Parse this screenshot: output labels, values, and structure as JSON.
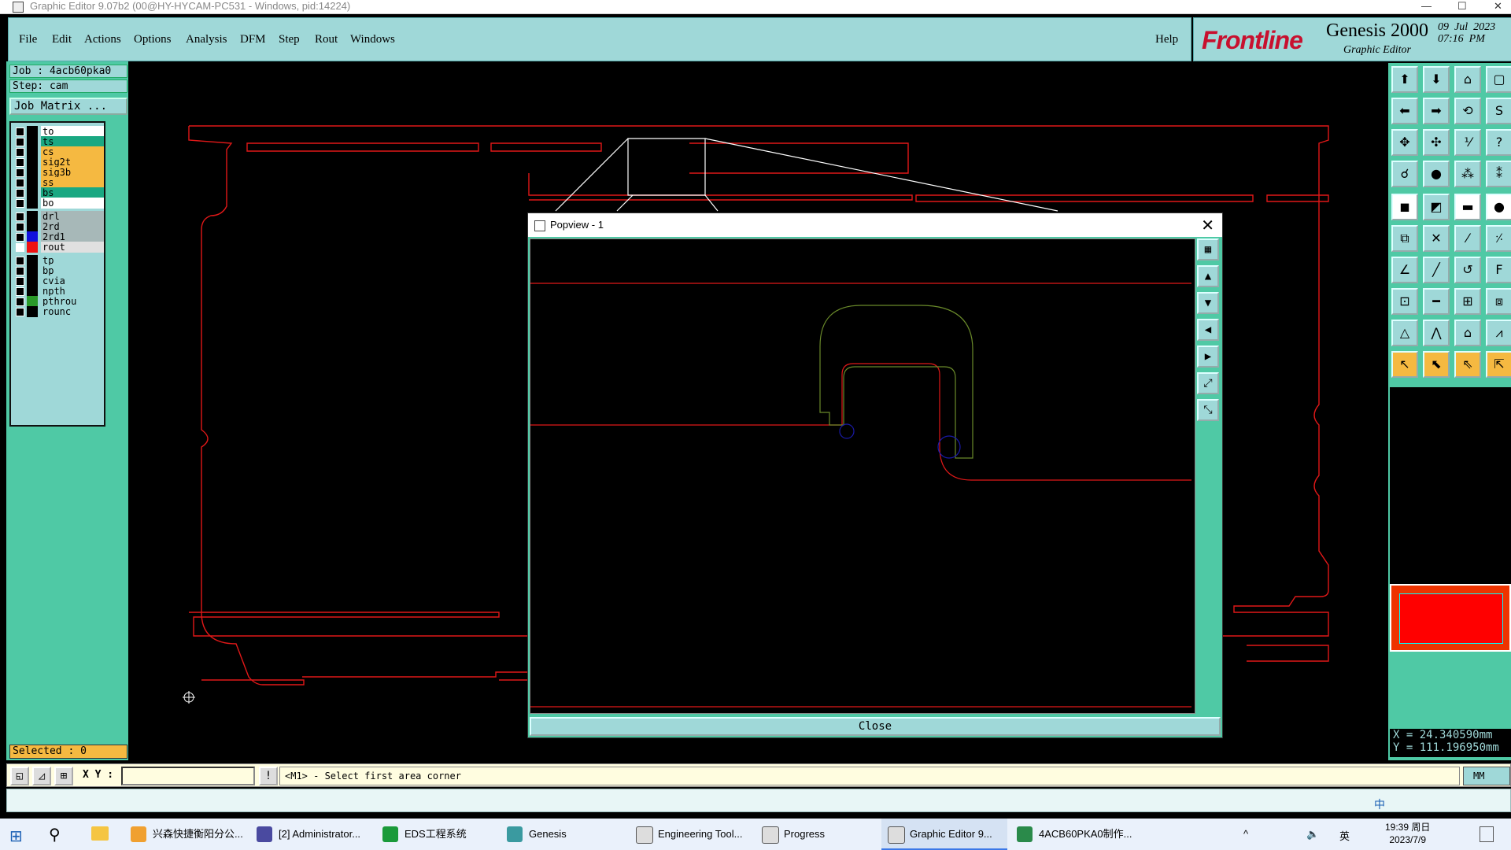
{
  "window": {
    "title": "Graphic Editor 9.07b2 (00@HY-HYCAM-PC531 - Windows, pid:14224)",
    "minimize": "—",
    "maximize": "☐",
    "close": "✕"
  },
  "menu": [
    "File",
    "Edit",
    "Actions",
    "Options",
    "Analysis",
    "DFM",
    "Step",
    "Rout",
    "Windows"
  ],
  "help": "Help",
  "brand": {
    "logo": "Frontline",
    "product": "Genesis 2000",
    "subtitle": "Graphic Editor",
    "date": "09  Jul  2023",
    "time": "07:16  PM"
  },
  "job": {
    "job": "Job : 4acb60pka0",
    "step": "Step: cam",
    "matrix": "Job Matrix ..."
  },
  "layers": [
    {
      "name": "to",
      "color": "#ffffff",
      "swatch": "#000000",
      "checked": false
    },
    {
      "name": "ts",
      "color": "#1aa882",
      "swatch": "#000000",
      "checked": false
    },
    {
      "name": "cs",
      "color": "#f5b941",
      "swatch": "#000000",
      "checked": false
    },
    {
      "name": "sig2t",
      "color": "#f5b941",
      "swatch": "#000000",
      "checked": false
    },
    {
      "name": "sig3b",
      "color": "#f5b941",
      "swatch": "#000000",
      "checked": false
    },
    {
      "name": "ss",
      "color": "#f5b941",
      "swatch": "#000000",
      "checked": false
    },
    {
      "name": "bs",
      "color": "#1aa882",
      "swatch": "#000000",
      "checked": false
    },
    {
      "name": "bo",
      "color": "#ffffff",
      "swatch": "#000000",
      "checked": false
    },
    {
      "name": "drl",
      "color": "#a7b8b8",
      "swatch": "#000000",
      "checked": false
    },
    {
      "name": "2rd",
      "color": "#a7b8b8",
      "swatch": "#000000",
      "checked": false
    },
    {
      "name": "2rd1",
      "color": "#a7b8b8",
      "swatch": "#1111dd",
      "checked": false
    },
    {
      "name": "rout",
      "color": "#e0e0e0",
      "swatch": "#ee1111",
      "checked": true
    },
    {
      "name": "tp",
      "color": "#9fd8d8",
      "swatch": "#000000",
      "checked": false
    },
    {
      "name": "bp",
      "color": "#9fd8d8",
      "swatch": "#000000",
      "checked": false
    },
    {
      "name": "cvia",
      "color": "#9fd8d8",
      "swatch": "#000000",
      "checked": false
    },
    {
      "name": "npth",
      "color": "#9fd8d8",
      "swatch": "#000000",
      "checked": false
    },
    {
      "name": "pthrou",
      "color": "#9fd8d8",
      "swatch": "#2a9a2a",
      "checked": false
    },
    {
      "name": "rounc",
      "color": "#9fd8d8",
      "swatch": "#000000",
      "checked": false
    }
  ],
  "selected": "Selected : 0",
  "coords": {
    "x": "X = 24.340590mm",
    "y": "Y = 111.196950mm"
  },
  "command": {
    "xy_label": "X Y :",
    "excl": "!",
    "prompt": "<M1> - Select first area corner",
    "units": "MM"
  },
  "popview": {
    "title": "Popview - 1",
    "close": "Close"
  },
  "taskbar": {
    "items": [
      "兴森快捷衡阳分公...",
      "[2] Administrator...",
      "EDS工程系统",
      "Genesis",
      "Engineering Tool...",
      "Progress",
      "Graphic Editor 9...",
      "4ACB60PKA0制作..."
    ],
    "tray_lang": "英",
    "tray_ime": "中",
    "time": "19:39 周日",
    "date": "2023/7/9"
  },
  "colors": {
    "panel": "#4fc9a5",
    "light": "#9fd8d8",
    "outline": "#e01818",
    "accent": "#f5b941"
  }
}
